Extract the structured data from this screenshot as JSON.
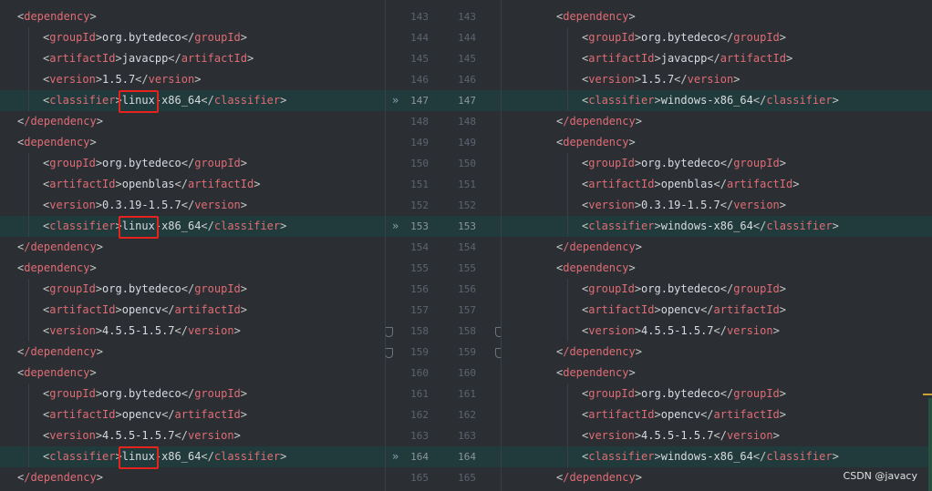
{
  "left_lines": [
    {
      "indent": 0,
      "open": "dependency",
      "text": "",
      "close": ""
    },
    {
      "indent": 1,
      "open": "groupId",
      "text": "org.bytedeco",
      "close": "groupId"
    },
    {
      "indent": 1,
      "open": "artifactId",
      "text": "javacpp",
      "close": "artifactId"
    },
    {
      "indent": 1,
      "open": "version",
      "text": "1.5.7",
      "close": "version"
    },
    {
      "indent": 1,
      "open": "classifier",
      "text": "linux-x86_64",
      "close": "classifier",
      "changed": true,
      "boxed": true
    },
    {
      "indent": 0,
      "open": "/dependency",
      "text": "",
      "close": ""
    },
    {
      "indent": 0,
      "open": "dependency",
      "text": "",
      "close": ""
    },
    {
      "indent": 1,
      "open": "groupId",
      "text": "org.bytedeco",
      "close": "groupId"
    },
    {
      "indent": 1,
      "open": "artifactId",
      "text": "openblas",
      "close": "artifactId"
    },
    {
      "indent": 1,
      "open": "version",
      "text": "0.3.19-1.5.7",
      "close": "version"
    },
    {
      "indent": 1,
      "open": "classifier",
      "text": "linux-x86_64",
      "close": "classifier",
      "changed": true,
      "boxed": true
    },
    {
      "indent": 0,
      "open": "/dependency",
      "text": "",
      "close": ""
    },
    {
      "indent": 0,
      "open": "dependency",
      "text": "",
      "close": ""
    },
    {
      "indent": 1,
      "open": "groupId",
      "text": "org.bytedeco",
      "close": "groupId"
    },
    {
      "indent": 1,
      "open": "artifactId",
      "text": "opencv",
      "close": "artifactId"
    },
    {
      "indent": 1,
      "open": "version",
      "text": "4.5.5-1.5.7",
      "close": "version"
    },
    {
      "indent": 0,
      "open": "/dependency",
      "text": "",
      "close": ""
    },
    {
      "indent": 0,
      "open": "dependency",
      "text": "",
      "close": ""
    },
    {
      "indent": 1,
      "open": "groupId",
      "text": "org.bytedeco",
      "close": "groupId"
    },
    {
      "indent": 1,
      "open": "artifactId",
      "text": "opencv",
      "close": "artifactId"
    },
    {
      "indent": 1,
      "open": "version",
      "text": "4.5.5-1.5.7",
      "close": "version"
    },
    {
      "indent": 1,
      "open": "classifier",
      "text": "linux-x86_64",
      "close": "classifier",
      "changed": true,
      "boxed": true
    },
    {
      "indent": 0,
      "open": "/dependency",
      "text": "",
      "close": ""
    }
  ],
  "right_lines": [
    {
      "indent": 0,
      "open": "dependency",
      "text": "",
      "close": ""
    },
    {
      "indent": 1,
      "open": "groupId",
      "text": "org.bytedeco",
      "close": "groupId"
    },
    {
      "indent": 1,
      "open": "artifactId",
      "text": "javacpp",
      "close": "artifactId"
    },
    {
      "indent": 1,
      "open": "version",
      "text": "1.5.7",
      "close": "version"
    },
    {
      "indent": 1,
      "open": "classifier",
      "text": "windows-x86_64",
      "close": "classifier",
      "changed": true
    },
    {
      "indent": 0,
      "open": "/dependency",
      "text": "",
      "close": ""
    },
    {
      "indent": 0,
      "open": "dependency",
      "text": "",
      "close": ""
    },
    {
      "indent": 1,
      "open": "groupId",
      "text": "org.bytedeco",
      "close": "groupId"
    },
    {
      "indent": 1,
      "open": "artifactId",
      "text": "openblas",
      "close": "artifactId"
    },
    {
      "indent": 1,
      "open": "version",
      "text": "0.3.19-1.5.7",
      "close": "version"
    },
    {
      "indent": 1,
      "open": "classifier",
      "text": "windows-x86_64",
      "close": "classifier",
      "changed": true
    },
    {
      "indent": 0,
      "open": "/dependency",
      "text": "",
      "close": ""
    },
    {
      "indent": 0,
      "open": "dependency",
      "text": "",
      "close": ""
    },
    {
      "indent": 1,
      "open": "groupId",
      "text": "org.bytedeco",
      "close": "groupId"
    },
    {
      "indent": 1,
      "open": "artifactId",
      "text": "opencv",
      "close": "artifactId"
    },
    {
      "indent": 1,
      "open": "version",
      "text": "4.5.5-1.5.7",
      "close": "version"
    },
    {
      "indent": 0,
      "open": "/dependency",
      "text": "",
      "close": ""
    },
    {
      "indent": 0,
      "open": "dependency",
      "text": "",
      "close": ""
    },
    {
      "indent": 1,
      "open": "groupId",
      "text": "org.bytedeco",
      "close": "groupId"
    },
    {
      "indent": 1,
      "open": "artifactId",
      "text": "opencv",
      "close": "artifactId"
    },
    {
      "indent": 1,
      "open": "version",
      "text": "4.5.5-1.5.7",
      "close": "version"
    },
    {
      "indent": 1,
      "open": "classifier",
      "text": "windows-x86_64",
      "close": "classifier",
      "changed": true
    },
    {
      "indent": 0,
      "open": "/dependency",
      "text": "",
      "close": ""
    }
  ],
  "line_numbers": [
    "143",
    "144",
    "145",
    "146",
    "147",
    "148",
    "149",
    "150",
    "151",
    "152",
    "153",
    "154",
    "155",
    "156",
    "157",
    "158",
    "159",
    "160",
    "161",
    "162",
    "163",
    "164",
    "165"
  ],
  "changed_rows": [
    4,
    10,
    21
  ],
  "fold_rows": [
    15,
    16
  ],
  "icons": {
    "diff_arrow": "double-chevron-right-icon",
    "fold": "fold-marker-icon"
  },
  "watermark": "CSDN @javacy",
  "colors": {
    "tag": "#e06c75",
    "text": "#d7dae0",
    "changed_bg": "#213a3b",
    "highlight_box": "#e5221c",
    "background": "#2b2f33"
  }
}
